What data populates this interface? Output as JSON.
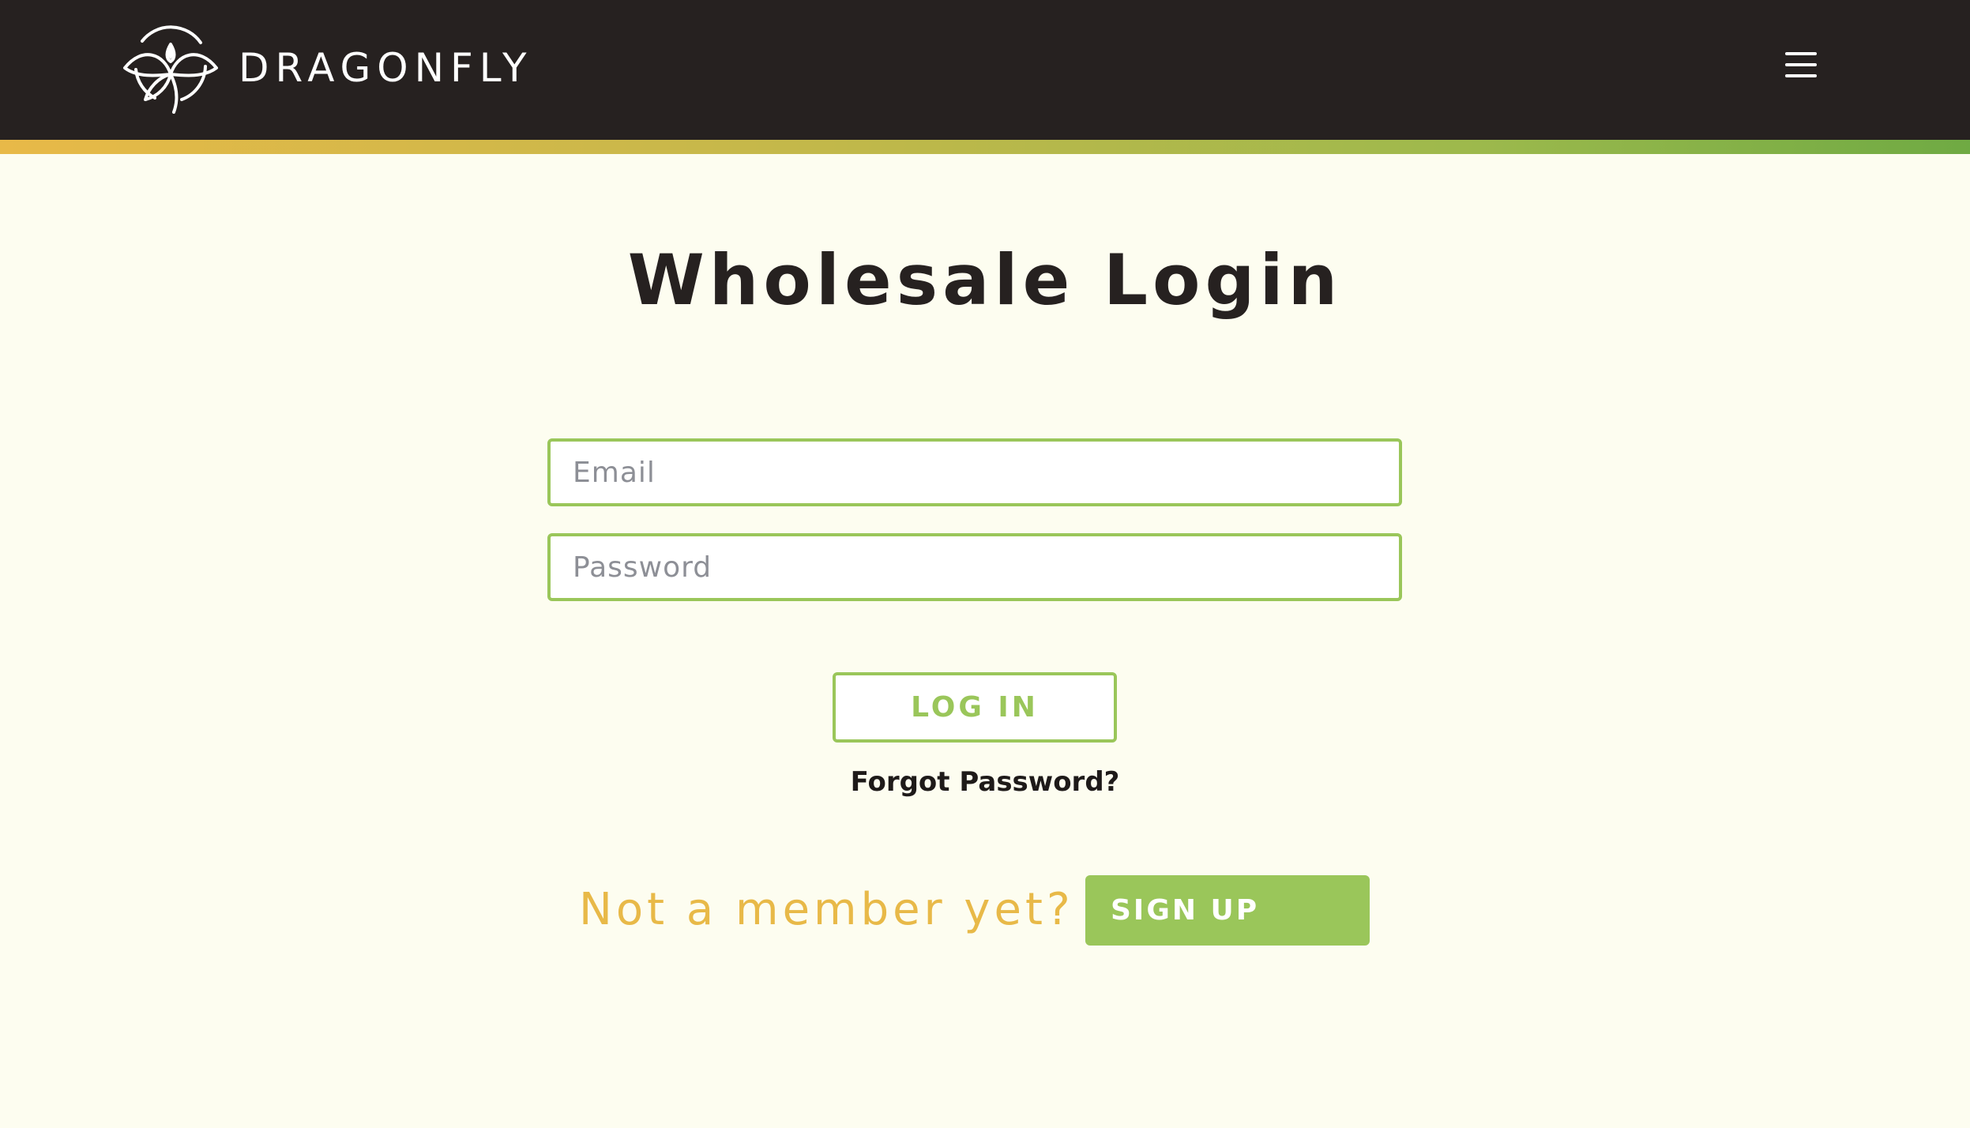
{
  "header": {
    "brand_name": "DRAGONFLY",
    "logo_icon": "dragonfly-lotus-logo-icon",
    "menu_icon": "hamburger-menu-icon"
  },
  "main": {
    "title": "Wholesale Login",
    "form": {
      "email_placeholder": "Email",
      "email_value": "",
      "password_placeholder": "Password",
      "password_value": ""
    },
    "login_label": "LOG IN",
    "forgot_label": "Forgot Password?",
    "signup_prompt": "Not a member yet?",
    "signup_label": "SIGN UP"
  },
  "colors": {
    "header_bg": "#262120",
    "page_bg": "#FDFDF0",
    "accent_green": "#9AC65A",
    "accent_yellow": "#E8B948",
    "stripe_end": "#6FAA43",
    "text_dark": "#262120"
  }
}
